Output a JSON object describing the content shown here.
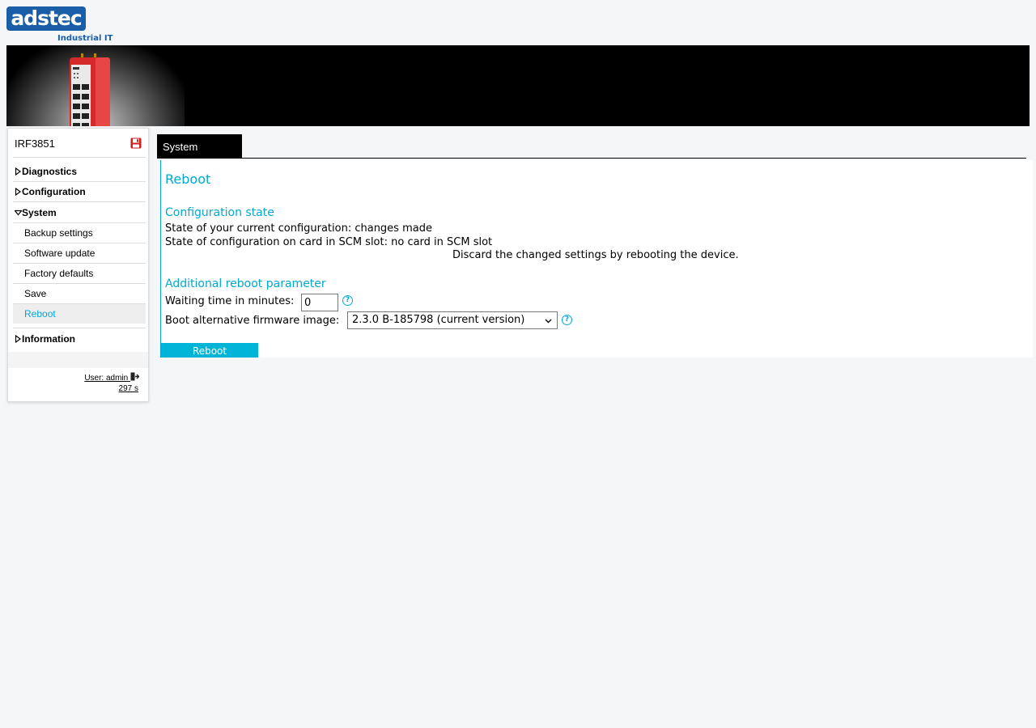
{
  "brand": {
    "logo_text": "adstec",
    "tagline": "Industrial IT"
  },
  "sidebar": {
    "device_name": "IRF3851",
    "items": [
      {
        "label": "Diagnostics",
        "expanded": false
      },
      {
        "label": "Configuration",
        "expanded": false
      },
      {
        "label": "System",
        "expanded": true
      },
      {
        "label": "Information",
        "expanded": false
      }
    ],
    "system_subitems": [
      {
        "label": "Backup settings",
        "active": false
      },
      {
        "label": "Software update",
        "active": false
      },
      {
        "label": "Factory defaults",
        "active": false
      },
      {
        "label": "Save",
        "active": false
      },
      {
        "label": "Reboot",
        "active": true
      }
    ],
    "user_label": "User: admin",
    "session_timer": "297 s"
  },
  "tabs": [
    {
      "label": "System",
      "active": true
    }
  ],
  "main": {
    "title": "Reboot",
    "config_state_heading": "Configuration state",
    "current_config_state": "State of your current configuration: changes made",
    "card_config_state": "State of configuration on card in SCM slot: no card in SCM slot",
    "discard_notice": "Discard the changed settings by rebooting the device.",
    "reboot_param_heading": "Additional reboot parameter",
    "waiting_label": "Waiting time in minutes:",
    "waiting_value": "0",
    "firmware_label": "Boot alternative firmware image:",
    "firmware_selected": "2.3.0 B-185798 (current version)",
    "help_glyph": "?",
    "reboot_button": "Reboot"
  },
  "colors": {
    "accent": "#00a9d4",
    "brand_blue": "#1a5ea8",
    "tab_bg": "#000000",
    "save_icon": "#cc1f1f"
  },
  "icons": {
    "save": "save-icon",
    "logout": "logout-icon",
    "help": "help-icon",
    "expand": "caret-right-icon",
    "collapse": "caret-down-icon"
  }
}
